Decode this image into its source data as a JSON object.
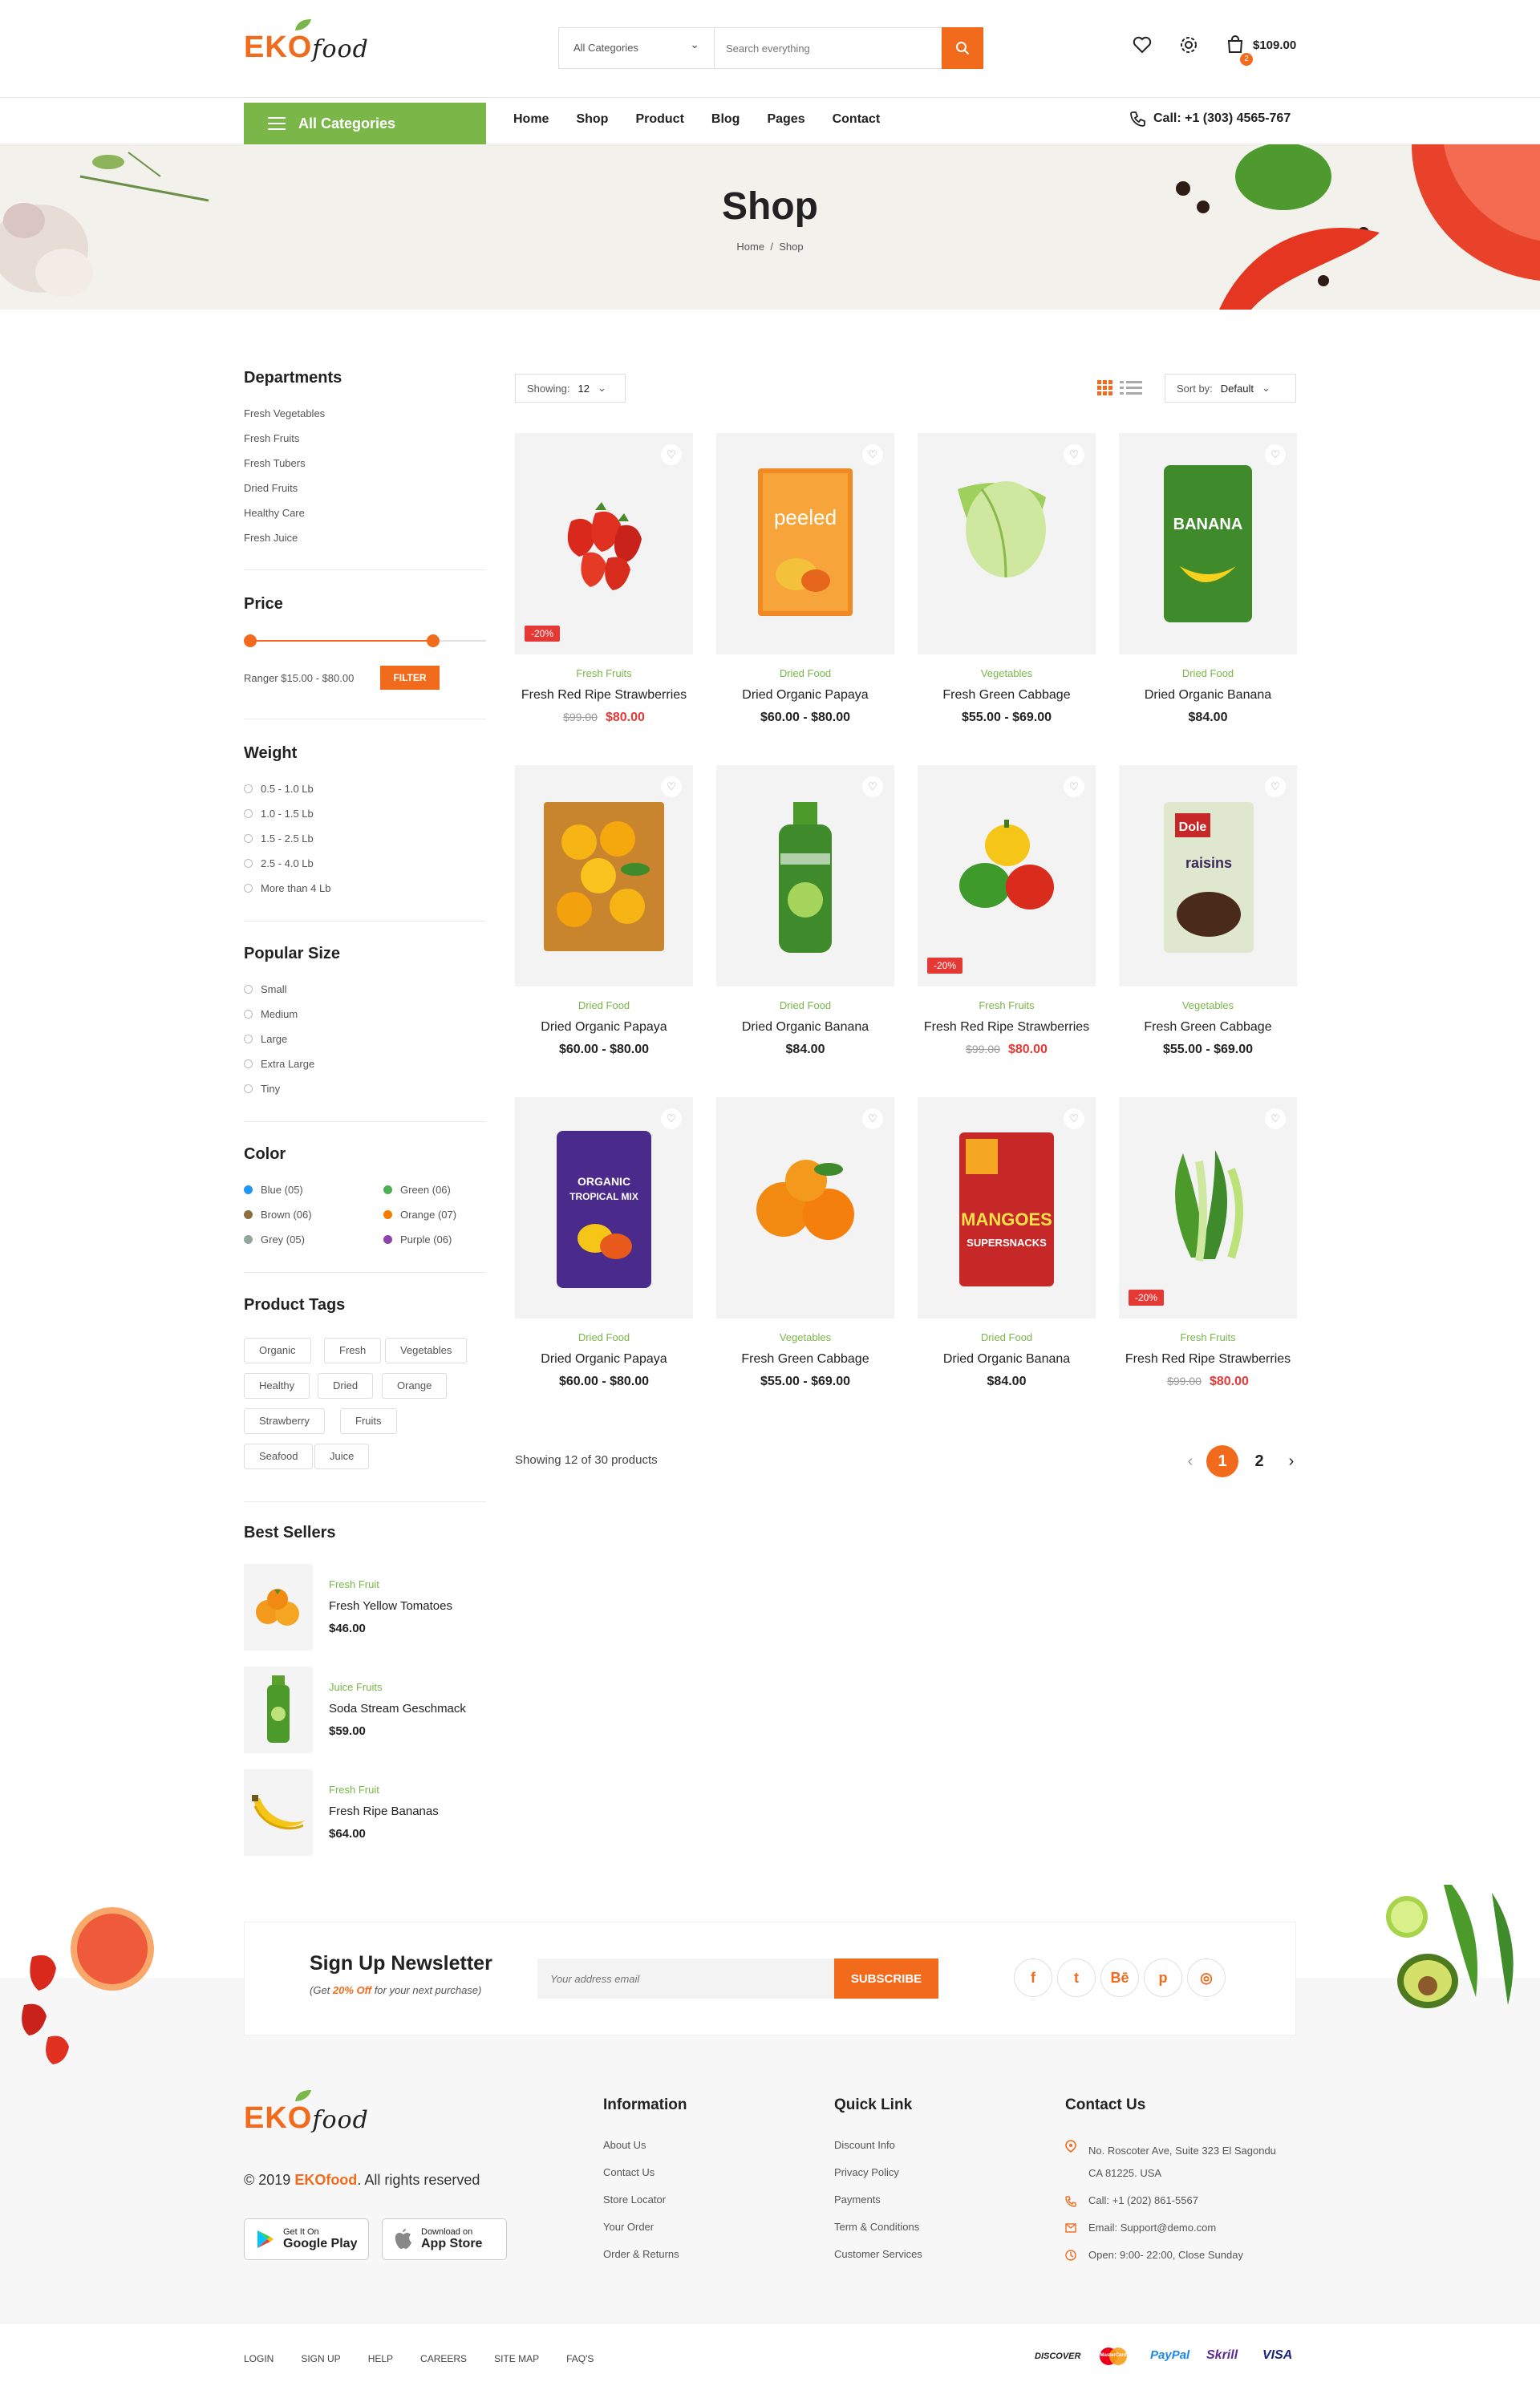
{
  "brand": {
    "logo_part1": "EKO",
    "logo_part2": "food"
  },
  "header": {
    "category_select": "All Categories",
    "search_placeholder": "Search everything",
    "cart_amount": "$109.00",
    "cart_count": "2"
  },
  "nav": {
    "all_categories": "All Categories",
    "links": [
      "Home",
      "Shop",
      "Product",
      "Blog",
      "Pages",
      "Contact"
    ],
    "phone": "Call: +1 (303) 4565-767"
  },
  "banner": {
    "title": "Shop",
    "breadcrumb_home": "Home",
    "breadcrumb_sep": "/",
    "breadcrumb_current": "Shop"
  },
  "sidebar": {
    "departments_title": "Departments",
    "departments": [
      "Fresh Vegetables",
      "Fresh Fruits",
      "Fresh Tubers",
      "Dried Fruits",
      "Healthy Care",
      "Fresh Juice"
    ],
    "price_title": "Price",
    "price_range": "Ranger $15.00 - $80.00",
    "filter_button": "FILTER",
    "weight_title": "Weight",
    "weights": [
      "0.5 - 1.0 Lb",
      "1.0 - 1.5 Lb",
      "1.5 - 2.5 Lb",
      "2.5 - 4.0 Lb",
      "More than 4 Lb"
    ],
    "size_title": "Popular Size",
    "sizes": [
      "Small",
      "Medium",
      "Large",
      "Extra Large",
      "Tiny"
    ],
    "color_title": "Color",
    "colors": [
      {
        "label": "Blue (05)",
        "hex": "#2196f3"
      },
      {
        "label": "Green (06)",
        "hex": "#4caf50"
      },
      {
        "label": "Brown (06)",
        "hex": "#8d6e3f"
      },
      {
        "label": "Orange (07)",
        "hex": "#f57c00"
      },
      {
        "label": "Grey (05)",
        "hex": "#8fa89a"
      },
      {
        "label": "Purple (06)",
        "hex": "#8e44ad"
      }
    ],
    "tags_title": "Product Tags",
    "tags": [
      "Organic",
      "Fresh",
      "Vegetables",
      "Healthy",
      "Dried",
      "Orange",
      "Strawberry",
      "Fruits",
      "Seafood",
      "Juice"
    ],
    "bestsellers_title": "Best Sellers",
    "bestsellers": [
      {
        "category": "Fresh Fruit",
        "name": "Fresh Yellow Tomatoes",
        "price": "$46.00"
      },
      {
        "category": "Juice Fruits",
        "name": "Soda Stream Geschmack",
        "price": "$59.00"
      },
      {
        "category": "Fresh Fruit",
        "name": "Fresh Ripe Bananas",
        "price": "$64.00"
      }
    ]
  },
  "shop": {
    "showing_label": "Showing:",
    "showing_value": "12",
    "sort_label": "Sort by:",
    "sort_value": "Default",
    "summary": "Showing 12 of 30 products",
    "pages": [
      "1",
      "2"
    ],
    "products": [
      {
        "category": "Fresh Fruits",
        "name": "Fresh Red Ripe Strawberries",
        "old_price": "$99.00",
        "price": "$80.00",
        "discount": "-20%"
      },
      {
        "category": "Dried Food",
        "name": "Dried Organic Papaya",
        "price": "$60.00 - $80.00"
      },
      {
        "category": "Vegetables",
        "name": "Fresh Green Cabbage",
        "price": "$55.00 - $69.00"
      },
      {
        "category": "Dried Food",
        "name": "Dried Organic Banana",
        "price": "$84.00"
      },
      {
        "category": "Dried Food",
        "name": "Dried Organic Papaya",
        "price": "$60.00 - $80.00"
      },
      {
        "category": "Dried Food",
        "name": "Dried Organic Banana",
        "price": "$84.00"
      },
      {
        "category": "Fresh Fruits",
        "name": "Fresh Red Ripe Strawberries",
        "old_price": "$99.00",
        "price": "$80.00",
        "discount": "-20%"
      },
      {
        "category": "Vegetables",
        "name": "Fresh Green Cabbage",
        "price": "$55.00 - $69.00"
      },
      {
        "category": "Dried Food",
        "name": "Dried Organic Papaya",
        "price": "$60.00 - $80.00"
      },
      {
        "category": "Vegetables",
        "name": "Fresh Green Cabbage",
        "price": "$55.00 - $69.00"
      },
      {
        "category": "Dried Food",
        "name": "Dried Organic Banana",
        "price": "$84.00"
      },
      {
        "category": "Fresh Fruits",
        "name": "Fresh Red Ripe Strawberries",
        "old_price": "$99.00",
        "price": "$80.00",
        "discount": "-20%"
      }
    ]
  },
  "newsletter": {
    "title": "Sign Up Newsletter",
    "sub_pre": "(Get ",
    "sub_highlight": "20% Off",
    "sub_post": " for your next purchase)",
    "placeholder": "Your address email",
    "button": "SUBSCRIBE"
  },
  "footer": {
    "copyright_pre": "© 2019 ",
    "copyright_brand": "EKOfood",
    "copyright_post": ". All rights reserved",
    "google_small": "Get It On",
    "google_big": "Google Play",
    "apple_small": "Download on",
    "apple_big": "App Store",
    "info_title": "Information",
    "info_links": [
      "About Us",
      "Contact Us",
      "Store Locator",
      "Your Order",
      "Order & Returns"
    ],
    "quick_title": "Quick Link",
    "quick_links": [
      "Discount Info",
      "Privacy Policy",
      "Payments",
      "Term & Conditions",
      "Customer Services"
    ],
    "contact_title": "Contact Us",
    "address_line1": "No. Roscoter Ave, Suite 323 El Sagondu",
    "address_line2": "CA 81225. USA",
    "call": "Call: +1 (202) 861-5567",
    "email": "Email: Support@demo.com",
    "open": "Open: 9:00- 22:00, Close Sunday",
    "bottom_links": [
      "LOGIN",
      "SIGN UP",
      "HELP",
      "CAREERS",
      "SITE MAP",
      "FAQ'S"
    ],
    "payments": [
      "DISCOVER",
      "MasterCard",
      "PayPal",
      "Skrill",
      "VISA"
    ]
  }
}
